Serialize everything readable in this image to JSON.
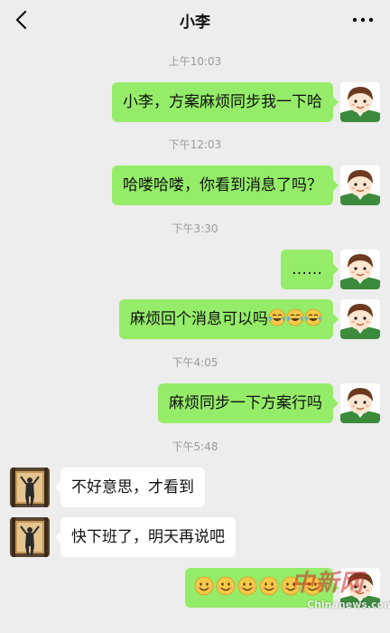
{
  "header": {
    "title": "小李",
    "back_icon": "chevron-left-icon",
    "more_icon": "more-dots-icon"
  },
  "messages": [
    {
      "time": "上午10:03"
    },
    {
      "from": "me",
      "text": "小李，方案麻烦同步我一下哈"
    },
    {
      "time": "下午12:03"
    },
    {
      "from": "me",
      "text": "哈喽哈喽，你看到消息了吗？"
    },
    {
      "time": "下午3:30"
    },
    {
      "from": "me",
      "text": "……"
    },
    {
      "from": "me",
      "text": "麻烦回个消息可以吗",
      "emojis": [
        "crying-laughing-emoji",
        "crying-laughing-emoji",
        "crying-laughing-emoji"
      ]
    },
    {
      "time": "下午4:05"
    },
    {
      "from": "me",
      "text": "麻烦同步一下方案行吗"
    },
    {
      "time": "下午5:48"
    },
    {
      "from": "other",
      "text": "不好意思，才看到"
    },
    {
      "from": "other",
      "text": "快下班了，明天再说吧"
    },
    {
      "from": "me",
      "emojis": [
        "smiley-emoji",
        "smiley-emoji",
        "smiley-emoji",
        "smiley-emoji",
        "smiley-emoji",
        "smiley-emoji"
      ]
    }
  ],
  "watermark": {
    "text": "中新网",
    "subtext": "Chinanews.com"
  },
  "colors": {
    "background": "#ededed",
    "my_bubble": "#95ec69",
    "other_bubble": "#ffffff",
    "timestamp": "#9a9a9a"
  }
}
